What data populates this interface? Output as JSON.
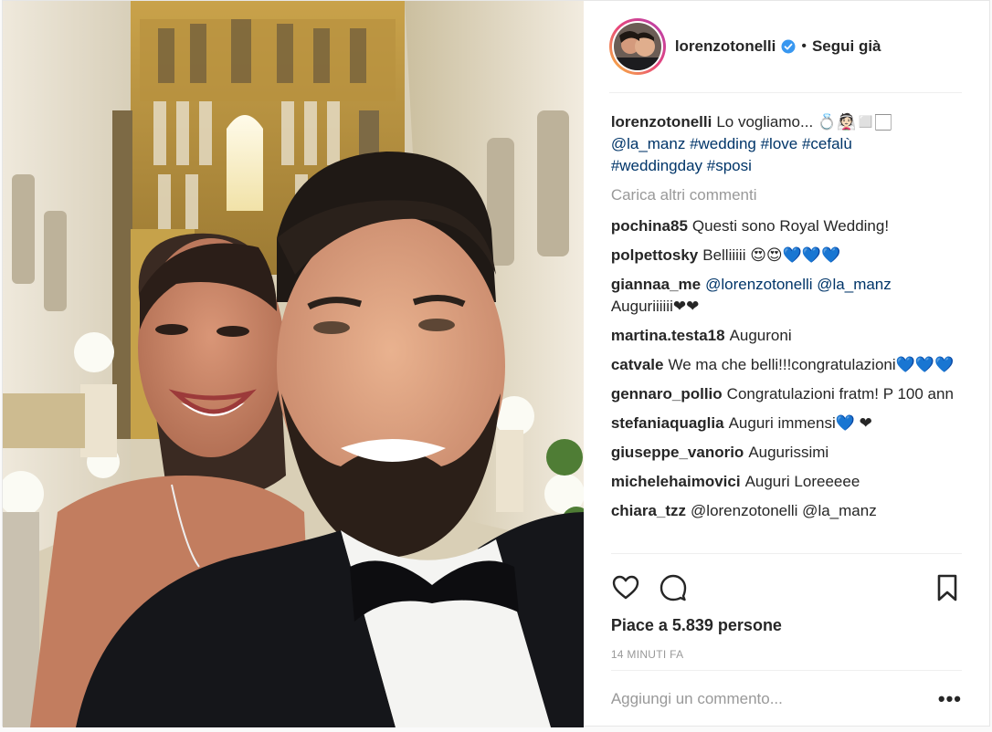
{
  "post": {
    "username": "lorenzotonelli",
    "separator": "•",
    "follow_label": "Segui già",
    "caption": {
      "user": "lorenzotonelli",
      "text": "Lo vogliamo... 💍👰🏻◻️🏻",
      "tags": [
        "@la_manz",
        "#wedding",
        "#love",
        "#cefalù",
        "#weddingday",
        "#sposi"
      ]
    },
    "load_more": "Carica altri commenti",
    "comments": [
      {
        "user": "pochina85",
        "text": "Questi sono Royal Wedding!"
      },
      {
        "user": "polpettosky",
        "text": "Belliiiii 😍😍💙💙💙"
      },
      {
        "user": "giannaa_me",
        "mentions": "@lorenzotonelli @la_manz",
        "text": "Auguriiiiii❤❤"
      },
      {
        "user": "martina.testa18",
        "text": "Auguroni"
      },
      {
        "user": "catvale",
        "text": "We ma che belli!!!congratulazioni💙💙💙"
      },
      {
        "user": "gennaro_pollio",
        "text": "Congratulazioni fratm! P 100 ann"
      },
      {
        "user": "stefaniaquaglia",
        "text": "Auguri immensi💙 ❤"
      },
      {
        "user": "giuseppe_vanorio",
        "text": "Augurissimi"
      },
      {
        "user": "michelehaimovici",
        "text": "Auguri Loreeeee"
      },
      {
        "user": "chiara_tzz",
        "text": "@lorenzotonelli @la_manz"
      }
    ],
    "likes_text": "Piace a 5.839 persone",
    "time_ago": "14 MINUTI FA",
    "add_comment_placeholder": "Aggiungi un commento...",
    "more_options": "•••",
    "colors": {
      "link": "#003569",
      "muted": "#999999",
      "verified": "#3897f0"
    }
  }
}
